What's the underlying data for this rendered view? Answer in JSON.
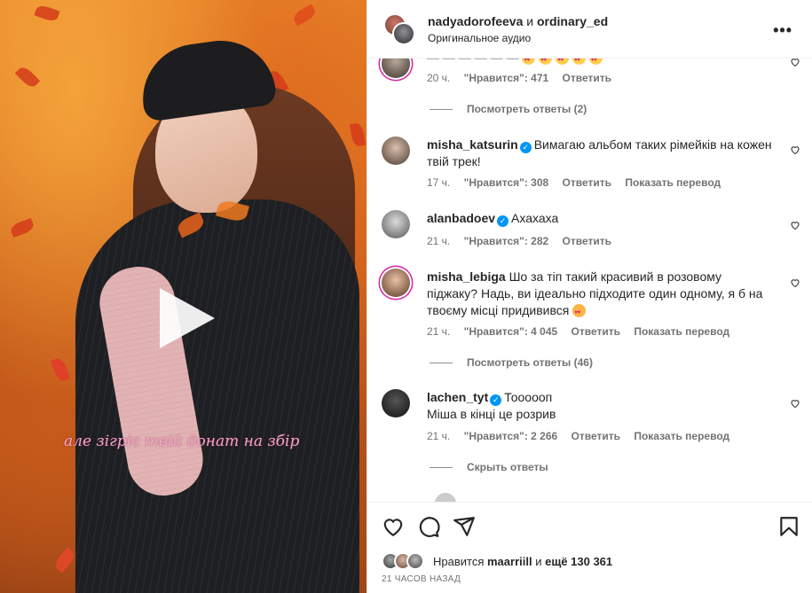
{
  "video": {
    "caption": "але зігріє твій донат на збір"
  },
  "header": {
    "user1": "nadyadorofeeva",
    "conj": "и",
    "user2": "ordinary_ed",
    "audio": "Оригинальное аудио",
    "more": "•••"
  },
  "comments": [
    {
      "user": "",
      "text": "",
      "time": "20 ч.",
      "likes": "\"Нравится\": 471",
      "reply": "Ответить",
      "translate": "",
      "view_replies": "Посмотреть ответы (2)"
    },
    {
      "user": "misha_katsurin",
      "text": "Вимагаю альбом таких рімейків на кожен твій трек!",
      "time": "17 ч.",
      "likes": "\"Нравится\": 308",
      "reply": "Ответить",
      "translate": "Показать перевод"
    },
    {
      "user": "alanbadoev",
      "text": "Ахахаха",
      "time": "21 ч.",
      "likes": "\"Нравится\": 282",
      "reply": "Ответить"
    },
    {
      "user": "misha_lebiga",
      "text": "Шо за тіп такий красивий в розовому піджаку? Надь, ви ідеально підходите один одному, я б на твоєму місці придивився",
      "time": "21 ч.",
      "likes": "\"Нравится\": 4 045",
      "reply": "Ответить",
      "translate": "Показать перевод",
      "view_replies": "Посмотреть ответы (46)"
    },
    {
      "user": "lachen_tyt",
      "text_line1": "Тоооооп",
      "text_line2": "Міша в кінці це розрив",
      "time": "21 ч.",
      "likes": "\"Нравится\": 2 266",
      "reply": "Ответить",
      "translate": "Показать перевод",
      "hide_replies": "Скрыть ответы"
    }
  ],
  "actions": {
    "likes_prefix": "Нравится",
    "likes_user": "maarriill",
    "likes_mid": "и",
    "likes_count": "ещё 130 361",
    "posted": "21 ЧАСОВ НАЗАД"
  },
  "colors": {
    "verified": "#0095f6",
    "meta": "#737373",
    "text": "#262626"
  }
}
